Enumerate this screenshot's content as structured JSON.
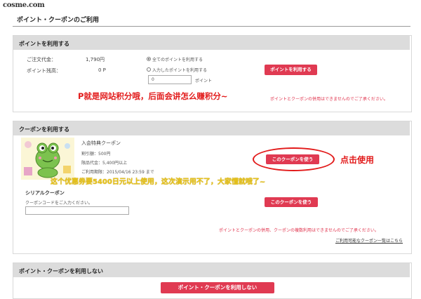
{
  "header": {
    "logo_text": "cosme.com",
    "page_title": "ポイント・クーポンのご利用"
  },
  "points": {
    "title": "ポイントを利用する",
    "order_amount_label": "ご注文代金：",
    "order_amount_value": "1,790円",
    "balance_label": "ポイント残高：",
    "balance_value": "0 P",
    "option_all": "全てのポイントを利用する",
    "option_input": "入力したポイントを利用する",
    "input_value": "0",
    "unit": "ポイント",
    "button": "ポイントを利用する",
    "note": "ポイントとクーポンの併用はできませんのでご了承ください。"
  },
  "coupons": {
    "title": "クーポンを利用する",
    "coupon_name": "入会特典クーポン",
    "discount": "割引額：500円",
    "min_amount": "限品代金：5,400円以上",
    "expiry": "ご利用期限：2015/04/16 23:59 まで",
    "use_button": "このクーポンを使う",
    "serial_title": "シリアルクーポン",
    "serial_prompt": "クーポンコードをご入力ください。",
    "serial_button": "このクーポンを使う",
    "note": "ポイントとクーポンの併用、クーポンの複数利用はできませんのでご了承ください。",
    "list_link": "ご利用可能なクーポン一覧はこちら"
  },
  "no_use": {
    "title": "ポイント・クーポンを利用しない",
    "button": "ポイント・クーポンを利用しない"
  },
  "annotations": {
    "points_note": "P就是网站积分哦，后面会讲怎么赚积分~",
    "click_note": "点击使用",
    "coupon_note": "这个优惠券要5400日元以上使用，这次演示用不了，大家懂就哦了~"
  },
  "colors": {
    "primary_button": "#e03a52",
    "annotation_red": "#e21b1b",
    "annotation_yellow": "#e6c21a",
    "section_header": "#dcdcdc"
  }
}
